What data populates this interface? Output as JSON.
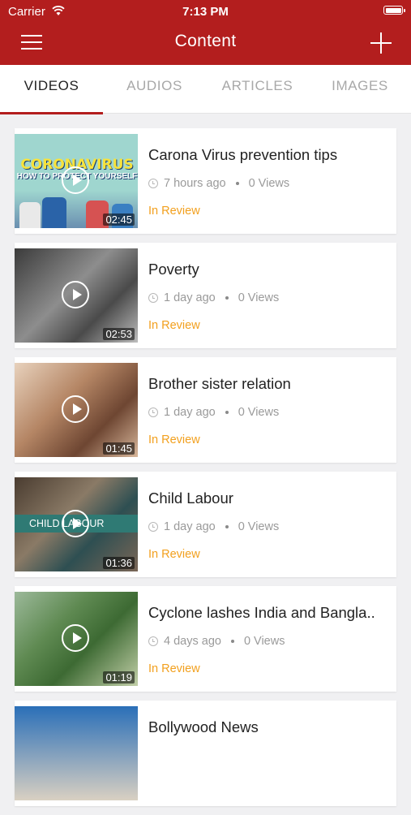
{
  "status_bar": {
    "carrier": "Carrier",
    "time": "7:13 PM"
  },
  "nav": {
    "title": "Content"
  },
  "tabs": [
    {
      "label": "VIDEOS",
      "active": true
    },
    {
      "label": "AUDIOS",
      "active": false
    },
    {
      "label": "ARTICLES",
      "active": false
    },
    {
      "label": "IMAGES",
      "active": false
    }
  ],
  "colors": {
    "brand": "#b31e1e",
    "status_review": "#f2a01e"
  },
  "videos": [
    {
      "title": "Carona Virus prevention tips",
      "time": "7 hours ago",
      "views": "0 Views",
      "status": "In Review",
      "duration": "02:45",
      "thumb_text": "CORONAVIRUS",
      "thumb_subtext": "HOW TO PROTECT YOURSELF"
    },
    {
      "title": "Poverty",
      "time": "1 day ago",
      "views": "0 Views",
      "status": "In Review",
      "duration": "02:53"
    },
    {
      "title": "Brother sister relation",
      "time": "1 day ago",
      "views": "0 Views",
      "status": "In Review",
      "duration": "01:45"
    },
    {
      "title": "Child Labour",
      "time": "1 day ago",
      "views": "0 Views",
      "status": "In Review",
      "duration": "01:36",
      "thumb_text": "CHILD LABOUR"
    },
    {
      "title": "Cyclone lashes India and Bangla..",
      "time": "4 days ago",
      "views": "0 Views",
      "status": "In Review",
      "duration": "01:19"
    },
    {
      "title": "Bollywood News"
    }
  ]
}
